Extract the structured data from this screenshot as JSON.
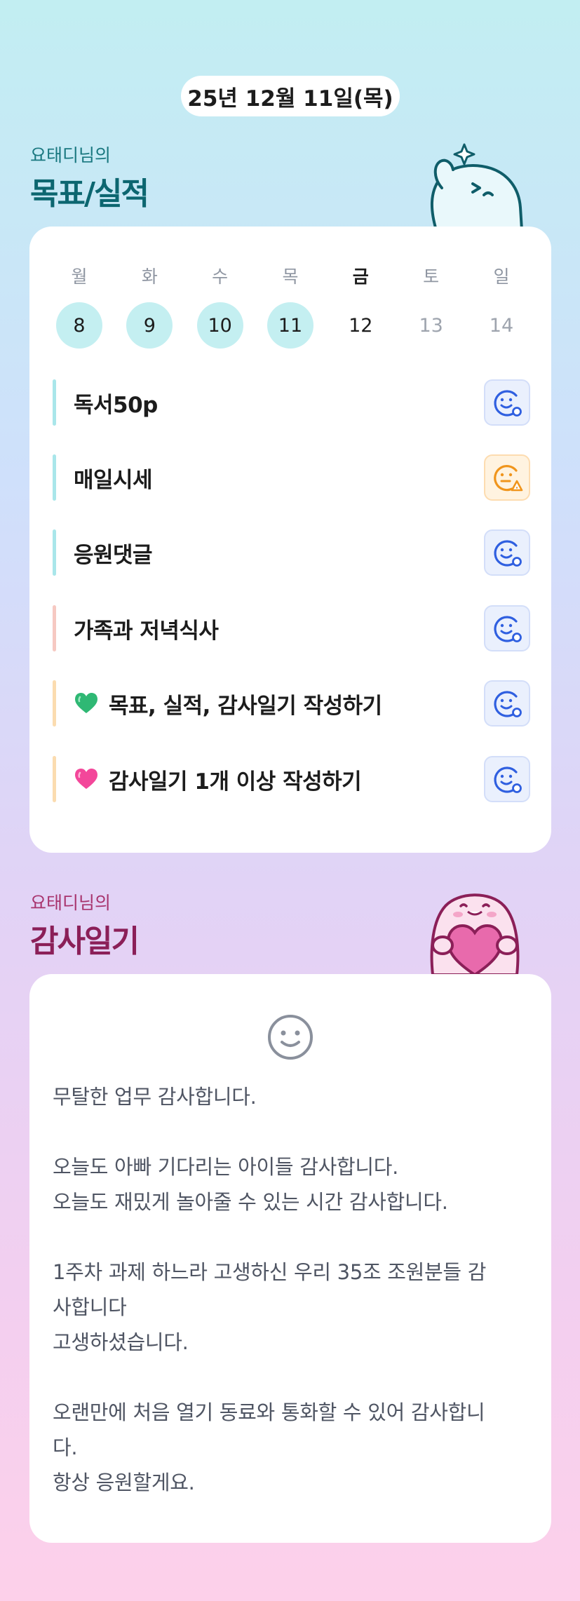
{
  "header": {
    "date": "25년 12월 11일(목)"
  },
  "goals_section": {
    "subtitle": "요태디님의",
    "title": "목표/실적"
  },
  "calendar": {
    "weekdays": [
      "월",
      "화",
      "수",
      "목",
      "금",
      "토",
      "일"
    ],
    "days": [
      "8",
      "9",
      "10",
      "11",
      "12",
      "13",
      "14"
    ]
  },
  "goals": [
    {
      "text": "독서50p",
      "bar_color": "#a9e6ea",
      "status": "blue-smile-icon"
    },
    {
      "text": "매일시세",
      "bar_color": "#a9e6ea",
      "status": "orange-warning-icon"
    },
    {
      "text": "응원댓글",
      "bar_color": "#a9e6ea",
      "status": "blue-smile-icon"
    },
    {
      "text": "가족과 저녁식사",
      "bar_color": "#f6c9c2",
      "status": "blue-smile-icon"
    },
    {
      "text": "목표, 실적, 감사일기 작성하기",
      "bar_color": "#fbdcb0",
      "emoji": "green-heart-icon",
      "status": "blue-smile-icon"
    },
    {
      "text": "감사일기 1개 이상 작성하기",
      "bar_color": "#fbdcb0",
      "emoji": "pink-heart-icon",
      "status": "blue-smile-icon"
    }
  ],
  "diary_section": {
    "subtitle": "요태디님의",
    "title": "감사일기"
  },
  "diary": {
    "content": "무탈한 업무 감사합니다.\n\n오늘도 아빠 기다리는 아이들 감사합니다.\n오늘도 재밌게 놀아줄 수 있는 시간 감사합니다.\n\n1주차 과제 하느라 고생하신 우리 35조 조원분들 감\n사합니다\n고생하셨습니다.\n\n오랜만에 처음 열기 동료와 통화할 수 있어 감사합니\n다.\n항상 응원할게요."
  },
  "colors": {
    "done_day": "#c4eff1",
    "status_blue": "#2f5fe0",
    "status_orange": "#f0951c"
  }
}
